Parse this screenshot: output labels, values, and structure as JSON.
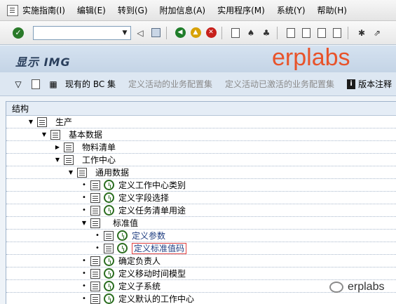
{
  "menu": {
    "items": [
      "实施指南(I)",
      "编辑(E)",
      "转到(G)",
      "附加信息(A)",
      "实用程序(M)",
      "系统(Y)",
      "帮助(H)"
    ]
  },
  "toolbar": {
    "command_value": ""
  },
  "title": {
    "text": "显示 IMG",
    "watermark": "erplabs"
  },
  "app_toolbar": {
    "bc_sets": "现有的 BC 集",
    "activity_bc": "定义活动的业务配置集",
    "activity_activated_bc": "定义活动已激活的业务配置集",
    "release_notes": "版本注释"
  },
  "tree": {
    "header": "结构",
    "rows": [
      {
        "label": "生产",
        "level": 0,
        "type": "folder"
      },
      {
        "label": "基本数据",
        "level": 1,
        "type": "folder"
      },
      {
        "label": "物料清单",
        "level": 2,
        "type": "folder-collapsed"
      },
      {
        "label": "工作中心",
        "level": 2,
        "type": "folder"
      },
      {
        "label": "通用数据",
        "level": 3,
        "type": "folder"
      },
      {
        "label": "定义工作中心类别",
        "level": 4,
        "type": "activity"
      },
      {
        "label": "定义字段选择",
        "level": 4,
        "type": "activity"
      },
      {
        "label": "定义任务清单用途",
        "level": 4,
        "type": "activity"
      },
      {
        "label": "标准值",
        "level": 4,
        "type": "folder"
      },
      {
        "label": "定义参数",
        "level": 5,
        "type": "activity-link"
      },
      {
        "label": "定义标准值码",
        "level": 5,
        "type": "activity-selected"
      },
      {
        "label": "确定负责人",
        "level": 4,
        "type": "activity"
      },
      {
        "label": "定义移动时间模型",
        "level": 4,
        "type": "activity"
      },
      {
        "label": "定义子系统",
        "level": 4,
        "type": "activity"
      },
      {
        "label": "定义默认的工作中心",
        "level": 4,
        "type": "activity"
      }
    ]
  },
  "footer_logo": "erplabs"
}
